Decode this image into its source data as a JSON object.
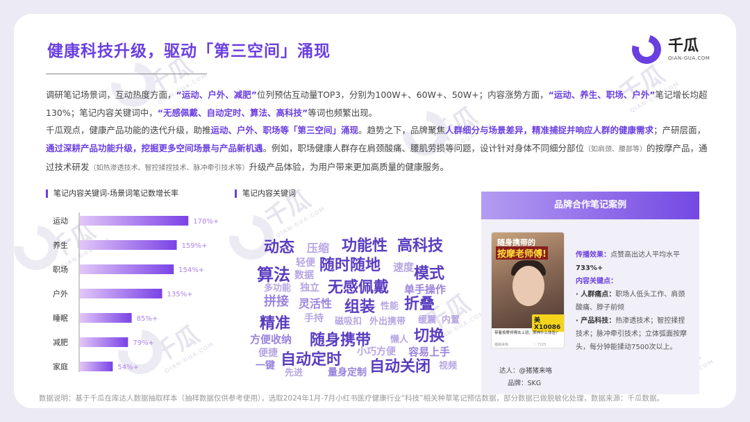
{
  "title": "健康科技升级，驱动「第三空间」涌现",
  "logo": {
    "text": "千瓜",
    "sub": "QIAN-GUA.COM"
  },
  "watermark": {
    "text": "千瓜",
    "sub": "QIAN-GUA.COM"
  },
  "paragraph": {
    "p1": [
      {
        "t": "调研笔记场景词，互动热度方面，",
        "s": "n"
      },
      {
        "t": "“运动、户外、减肥”",
        "s": "h"
      },
      {
        "t": "位列预估互动量TOP3，分别为100W+、60W+、50W+；内容涨势方面，",
        "s": "n"
      },
      {
        "t": "“运动、养生、职场、户外”",
        "s": "h"
      },
      {
        "t": "笔记增长均超130%；笔记内容关键词中，",
        "s": "n"
      },
      {
        "t": "“无感佩戴、自动定时、算法、高科技”",
        "s": "h"
      },
      {
        "t": "等词也频繁出现。",
        "s": "n"
      }
    ],
    "p2": [
      {
        "t": "千瓜观点，健康产品功能的迭代升级，助推",
        "s": "n"
      },
      {
        "t": "运动、户外、职场等「第三空间」涌现",
        "s": "h"
      },
      {
        "t": "。趋势之下，品牌聚焦",
        "s": "n"
      },
      {
        "t": "人群细分与场景差异，精准捕捉并响应人群的健康需求",
        "s": "h"
      },
      {
        "t": "；产研层面，",
        "s": "n"
      },
      {
        "t": "通过深耕产品功能升级，挖掘更多空间场景与产品新机遇",
        "s": "h"
      },
      {
        "t": "。例如，职场健康人群存在肩颈酸痛、腰肌劳损等问题，设计针对身体不同细分部位",
        "s": "n"
      },
      {
        "t": "（如肩颈、腰部等）",
        "s": "m"
      },
      {
        "t": "的按摩产品，通过技术研发",
        "s": "n"
      },
      {
        "t": "（如热渗透技术、智控揉捏技术、脉冲牵引技术等）",
        "s": "m"
      },
      {
        "t": "升级产品体验，为用户带来更加高质量的健康服务。",
        "s": "n"
      }
    ]
  },
  "chart_data": {
    "type": "bar",
    "orientation": "horizontal",
    "title": "笔记内容关键词-场景词笔记数增长率",
    "categories": [
      "运动",
      "养生",
      "职场",
      "户外",
      "睡眠",
      "减肥",
      "家庭"
    ],
    "values": [
      178,
      159,
      154,
      135,
      85,
      79,
      54
    ],
    "value_labels": [
      "178%+",
      "159%+",
      "154%+",
      "135%+",
      "85%+",
      "79%+",
      "54%+"
    ],
    "xlim": [
      0,
      180
    ],
    "colors": {
      "bar_start": "#e2c6f7",
      "bar_end": "#7a43e6",
      "label": "#b083e8"
    }
  },
  "wordcloud": {
    "title": "笔记内容关键词",
    "words": [
      {
        "t": "动态",
        "c": "#5a3dc0"
      },
      {
        "t": "压缩",
        "c": "#b7a6e3"
      },
      {
        "t": "功能性",
        "c": "#5a3dc0"
      },
      {
        "t": "高科技",
        "c": "#5a3dc0"
      },
      {
        "t": "轻便",
        "c": "#b7a6e3"
      },
      {
        "t": "数据",
        "c": "#b7a6e3"
      },
      {
        "t": "随时随地",
        "c": "#5a3dc0"
      },
      {
        "t": "速度",
        "c": "#b7a6e3"
      },
      {
        "t": "算法",
        "c": "#5a3dc0"
      },
      {
        "t": "模式",
        "c": "#5a3dc0"
      },
      {
        "t": "多功能",
        "c": "#b7a6e3"
      },
      {
        "t": "独立",
        "c": "#b7a6e3"
      },
      {
        "t": "无感佩戴",
        "c": "#5a3dc0"
      },
      {
        "t": "单手操作",
        "c": "#9b83dc"
      },
      {
        "t": "拼接",
        "c": "#9b83dc"
      },
      {
        "t": "灵活性",
        "c": "#9b83dc"
      },
      {
        "t": "组装",
        "c": "#5a3dc0"
      },
      {
        "t": "性能",
        "c": "#b7a6e3"
      },
      {
        "t": "折叠",
        "c": "#5a3dc0"
      },
      {
        "t": "手持",
        "c": "#b7a6e3"
      },
      {
        "t": "磁吸扣",
        "c": "#b7a6e3"
      },
      {
        "t": "外出携带",
        "c": "#b7a6e3"
      },
      {
        "t": "缓震",
        "c": "#b7a6e3"
      },
      {
        "t": "内置",
        "c": "#b7a6e3"
      },
      {
        "t": "精准",
        "c": "#5a3dc0"
      },
      {
        "t": "方便收纳",
        "c": "#9b83dc"
      },
      {
        "t": "随身携带",
        "c": "#5a3dc0"
      },
      {
        "t": "懒人",
        "c": "#b7a6e3"
      },
      {
        "t": "切换",
        "c": "#5a3dc0"
      },
      {
        "t": "便捷",
        "c": "#b7a6e3"
      },
      {
        "t": "小巧方便",
        "c": "#b7a6e3"
      },
      {
        "t": "容易上手",
        "c": "#9b83dc"
      },
      {
        "t": "自动定时",
        "c": "#5a3dc0"
      },
      {
        "t": "一键",
        "c": "#9b83dc"
      },
      {
        "t": "先进",
        "c": "#b7a6e3"
      },
      {
        "t": "量身定制",
        "c": "#9b83dc"
      },
      {
        "t": "自动关闭",
        "c": "#5a3dc0"
      },
      {
        "t": "视频",
        "c": "#b7a6e3"
      }
    ]
  },
  "case": {
    "title": "品牌合作笔记案例",
    "phone_title1": "随身携带的",
    "phone_title2": "按摩老师傅!",
    "phone_badge": "美X10086",
    "phone_caption": "带着按摩师傅去上班，摩神什么体验?",
    "phone_author": "猪猪来咯",
    "phone_likes": "7225",
    "influencer_label": "达人：",
    "influencer": "@猪猪来咯",
    "brand_label": "品牌：",
    "brand": "SKG",
    "effect_label": "传播效果：",
    "effect_text": "点赞高出达人平均水平",
    "effect_value": "733%+",
    "key_label": "内容关键点：",
    "k1_label": "· 人群痛点：",
    "k1_text": "职场人低头工作、肩颈酸痛、脖子前倾",
    "k2_label": "· 产品科技：",
    "k2_text": "热渗透技术；智控揉捏技术；脉冲牵引技术；立体弧面按摩头，每分钟能揉动7500次以上。"
  },
  "footnote": "数据说明：基于千瓜在库达人数据抽取样本（抽样数据仅供参考使用），选取2024年1月-7月小红书医疗健康行业“科技”相关种草笔记预估数据，部分数据已做脱敏化处理，数据来源：千瓜数据。"
}
